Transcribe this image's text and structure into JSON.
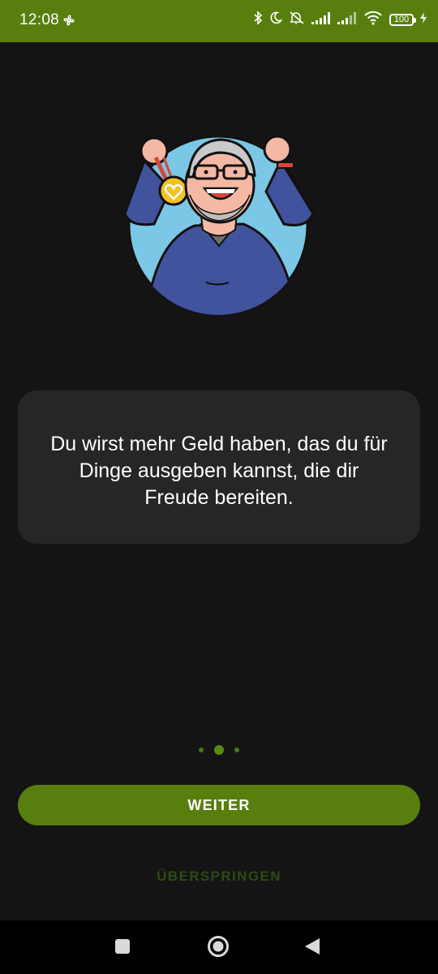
{
  "status_bar": {
    "time": "12:08",
    "battery": "100",
    "background": "#587f0e"
  },
  "onboarding": {
    "illustration": "senior-man-with-medal-illustration",
    "message": "Du wirst mehr Geld haben, das du für Dinge ausgeben kannst, die dir Freude bereiten.",
    "page_indicator": {
      "total": 3,
      "current": 2
    },
    "primary_button_label": "WEITER",
    "skip_label": "ÜBERSPRINGEN",
    "accent_color": "#587f0e"
  },
  "nav_bar": {
    "buttons": [
      "recents-button",
      "home-button",
      "back-button"
    ]
  }
}
